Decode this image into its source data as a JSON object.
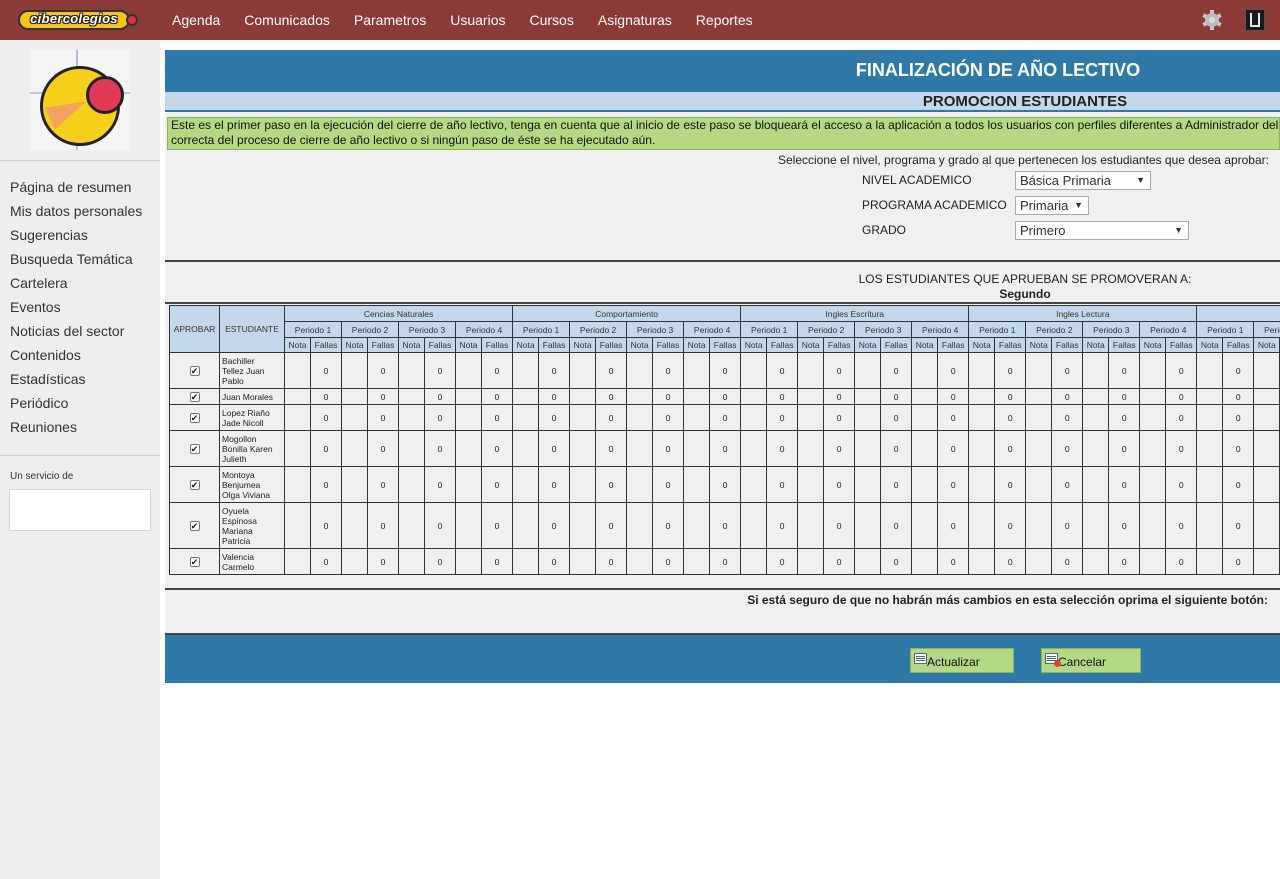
{
  "brand": {
    "name": "cibercolegios"
  },
  "nav": [
    "Agenda",
    "Comunicados",
    "Parametros",
    "Usuarios",
    "Cursos",
    "Asignaturas",
    "Reportes"
  ],
  "sidebar": {
    "items": [
      "Página de resumen",
      "Mis datos personales",
      "Sugerencias",
      "Busqueda Temática",
      "Cartelera",
      "Eventos",
      "Noticias del sector",
      "Contenidos",
      "Estadísticas",
      "Periódico",
      "Reuniones"
    ],
    "service_label": "Un servicio de"
  },
  "page": {
    "title": "FINALIZACIÓN DE AÑO LECTIVO",
    "subtitle": "PROMOCION ESTUDIANTES",
    "warning_line1": "Este es el primer paso en la ejecución del cierre de año lectivo, tenga en cuenta que al inicio de este paso se bloqueará el acceso a la aplicación a todos los usuarios con perfiles diferentes a Administrador del",
    "warning_line2": "correcta del proceso de cierre de año lectivo o si ningún paso de éste se ha ejecutado aún.",
    "select_intro": "Seleccione el nivel, programa y grado al que pertenecen los estudiantes que desea aprobar:"
  },
  "form": {
    "nivel_label": "NIVEL ACADEMICO",
    "nivel_value": "Básica Primaria",
    "programa_label": "PROGRAMA ACADEMICO",
    "programa_value": "Primaria",
    "grado_label": "GRADO",
    "grado_value": "Primero"
  },
  "promote": {
    "label": "LOS ESTUDIANTES QUE APRUEBAN SE PROMOVERAN A:",
    "value": "Segundo"
  },
  "table": {
    "col_aprobar": "APROBAR",
    "col_estudiante": "ESTUDIANTE",
    "subjects": [
      "Cencias Naturales",
      "Comportamiento",
      "Ingles Escritura",
      "Ingles Lectura",
      ""
    ],
    "periods": [
      "Periodo 1",
      "Periodo 2",
      "Periodo 3",
      "Periodo 4"
    ],
    "nota_label": "Nota",
    "fallas_label": "Fallas",
    "fallas_value": "0",
    "students": [
      {
        "lines": [
          "Bachiller",
          "Tellez Juan",
          "Pablo"
        ],
        "approved": true
      },
      {
        "lines": [
          "Juan Morales"
        ],
        "approved": true
      },
      {
        "lines": [
          "Lopez Riaño",
          "Jade Nicoll"
        ],
        "approved": true
      },
      {
        "lines": [
          "Mogollon",
          "Bonilla Karen",
          "Julieth"
        ],
        "approved": true
      },
      {
        "lines": [
          "Montoya",
          "Benjumea",
          "Olga Viviana"
        ],
        "approved": true
      },
      {
        "lines": [
          "Oyuela",
          "Espinosa",
          "Mariana",
          "Patricia"
        ],
        "approved": true
      },
      {
        "lines": [
          "Valencia",
          "Carmelo"
        ],
        "approved": true
      }
    ]
  },
  "bottom_message": "Si está seguro de que no habrán más cambios en esta selección oprima el siguiente botón:",
  "buttons": {
    "actualizar": "Actualizar",
    "cancelar": "Cancelar"
  },
  "colors": {
    "topbar": "#8b3a37",
    "header_blue": "#2e79a7",
    "light_blue": "#c3d8ea",
    "green": "#b5d883"
  }
}
